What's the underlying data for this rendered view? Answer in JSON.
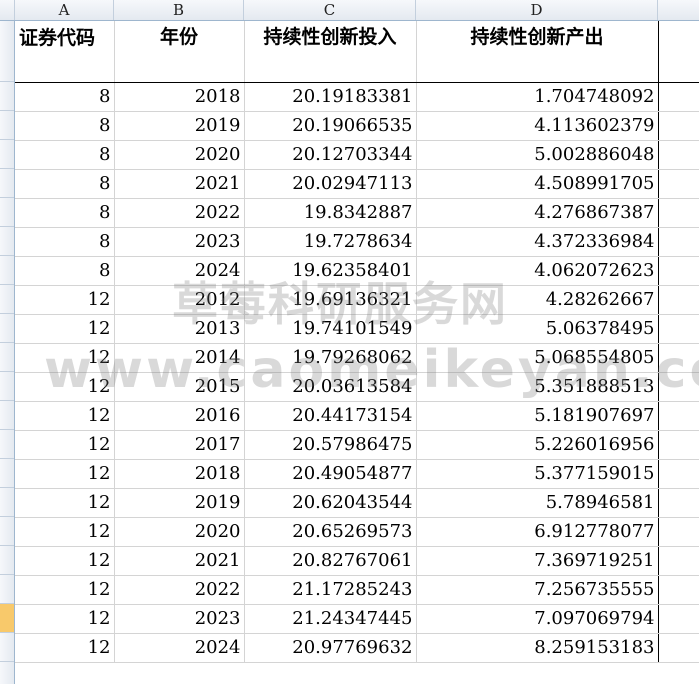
{
  "columns": [
    "A",
    "B",
    "C",
    "D"
  ],
  "headers": {
    "code": "证券代码",
    "year": "年份",
    "input": "持续性创新投入",
    "output": "持续性创新产出"
  },
  "rows": [
    {
      "code": "8",
      "year": "2018",
      "input": "20.19183381",
      "output": "1.704748092"
    },
    {
      "code": "8",
      "year": "2019",
      "input": "20.19066535",
      "output": "4.113602379"
    },
    {
      "code": "8",
      "year": "2020",
      "input": "20.12703344",
      "output": "5.002886048"
    },
    {
      "code": "8",
      "year": "2021",
      "input": "20.02947113",
      "output": "4.508991705"
    },
    {
      "code": "8",
      "year": "2022",
      "input": "19.8342887",
      "output": "4.276867387"
    },
    {
      "code": "8",
      "year": "2023",
      "input": "19.7278634",
      "output": "4.372336984"
    },
    {
      "code": "8",
      "year": "2024",
      "input": "19.62358401",
      "output": "4.062072623"
    },
    {
      "code": "12",
      "year": "2012",
      "input": "19.69136321",
      "output": "4.28262667"
    },
    {
      "code": "12",
      "year": "2013",
      "input": "19.74101549",
      "output": "5.06378495"
    },
    {
      "code": "12",
      "year": "2014",
      "input": "19.79268062",
      "output": "5.068554805"
    },
    {
      "code": "12",
      "year": "2015",
      "input": "20.03613584",
      "output": "5.351888513"
    },
    {
      "code": "12",
      "year": "2016",
      "input": "20.44173154",
      "output": "5.181907697"
    },
    {
      "code": "12",
      "year": "2017",
      "input": "20.57986475",
      "output": "5.226016956"
    },
    {
      "code": "12",
      "year": "2018",
      "input": "20.49054877",
      "output": "5.377159015"
    },
    {
      "code": "12",
      "year": "2019",
      "input": "20.62043544",
      "output": "5.78946581"
    },
    {
      "code": "12",
      "year": "2020",
      "input": "20.65269573",
      "output": "6.912778077"
    },
    {
      "code": "12",
      "year": "2021",
      "input": "20.82767061",
      "output": "7.369719251"
    },
    {
      "code": "12",
      "year": "2022",
      "input": "21.17285243",
      "output": "7.256735555"
    },
    {
      "code": "12",
      "year": "2023",
      "input": "21.24347445",
      "output": "7.097069794"
    },
    {
      "code": "12",
      "year": "2024",
      "input": "20.97769632",
      "output": "8.259153183"
    }
  ],
  "watermark": {
    "line1": "草莓科研服务网",
    "line2": "www.caomeikeyan.com"
  },
  "selected_row_index": 18,
  "colors": {
    "header_bar": "#e4e9f0",
    "selected_row": "#f8c96b",
    "gridline": "#d4d4d4"
  }
}
